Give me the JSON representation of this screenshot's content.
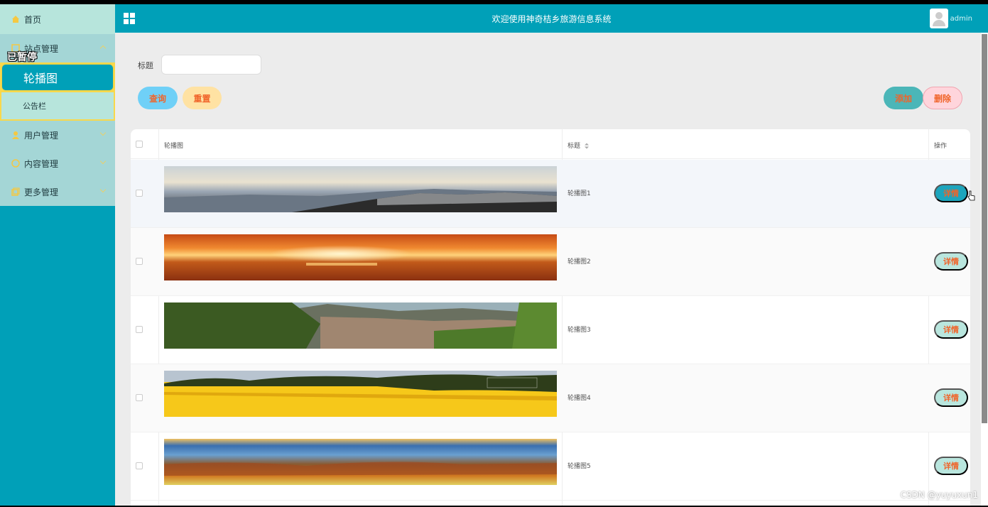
{
  "sidebar": {
    "paused_overlay": "已暂停",
    "items": [
      {
        "label": "首页",
        "icon": "home-icon"
      },
      {
        "label": "站点管理",
        "icon": "site-icon",
        "expanded": true,
        "children": [
          {
            "label": "轮播图",
            "active": true
          },
          {
            "label": "公告栏",
            "active": false
          }
        ]
      },
      {
        "label": "用户管理",
        "icon": "user-icon"
      },
      {
        "label": "内容管理",
        "icon": "chat-icon"
      },
      {
        "label": "更多管理",
        "icon": "copy-icon"
      }
    ]
  },
  "header": {
    "title": "欢迎使用神奇桔乡旅游信息系统",
    "user": "admin"
  },
  "search": {
    "label": "标题",
    "value": "",
    "query_label": "查询",
    "reset_label": "重置",
    "add_label": "添加",
    "delete_label": "删除"
  },
  "table": {
    "columns": [
      "轮播图",
      "标题",
      "操作"
    ],
    "rows": [
      {
        "title": "轮播图1",
        "action": "详情",
        "image": "mountain-range-landscape"
      },
      {
        "title": "轮播图2",
        "action": "详情",
        "image": "sunset-over-sea"
      },
      {
        "title": "轮播图3",
        "action": "详情",
        "image": "canyon-with-trees"
      },
      {
        "title": "轮播图4",
        "action": "详情",
        "image": "rapeseed-flower-field"
      },
      {
        "title": "轮播图5",
        "action": "详情",
        "image": "autumn-valley-landscape"
      }
    ]
  },
  "watermark": "CSDN @yuyuxun1",
  "colors": {
    "accent": "#00a0b8",
    "action_text": "#f0642a",
    "active_submenu_border": "#f9d84a"
  }
}
